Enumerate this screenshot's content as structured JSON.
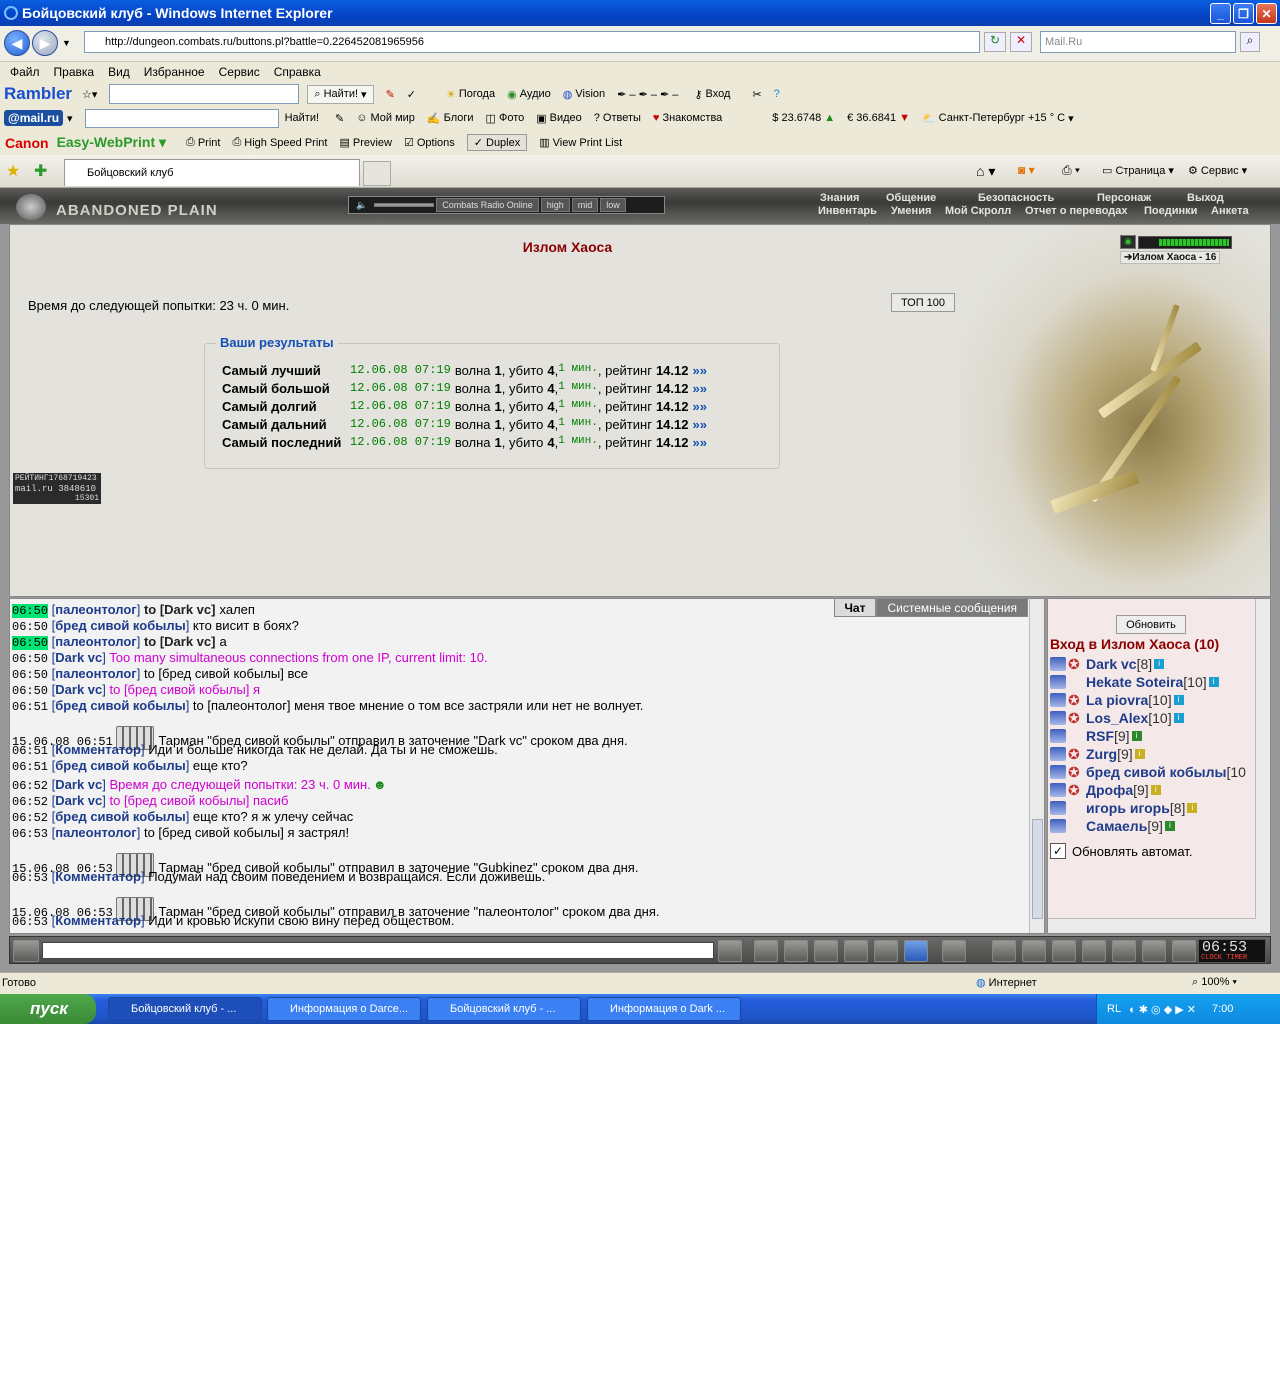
{
  "window": {
    "title": "Бойцовский клуб - Windows Internet Explorer"
  },
  "address": {
    "url": "http://dungeon.combats.ru/buttons.pl?battle=0.226452081965956",
    "search_placeholder": "Mail.Ru"
  },
  "menu": [
    "Файл",
    "Правка",
    "Вид",
    "Избранное",
    "Сервис",
    "Справка"
  ],
  "rambler": {
    "brand": "Rambler",
    "find": "Найти!",
    "items": [
      "Погода",
      "Аудио",
      "Vision",
      "Вход"
    ]
  },
  "mailru": {
    "brand": "@mail.ru",
    "find": "Найти!",
    "items": [
      "Мой мир",
      "Блоги",
      "Фото",
      "Видео",
      "Ответы",
      "Знакомства"
    ],
    "usd": "$ 23.6748",
    "eur": "€ 36.6841",
    "weather": "Санкт-Петербург +15 ° C"
  },
  "canon": {
    "brand": "Canon",
    "product": "Easy-WebPrint",
    "items": [
      "Print",
      "High Speed Print",
      "Preview",
      "Options",
      "Duplex",
      "View Print List"
    ]
  },
  "tabs": {
    "active": "Бойцовский клуб",
    "right_items": [
      "Страница",
      "Сервис"
    ]
  },
  "game": {
    "logo": "ABANDONED PLAIN",
    "radio": {
      "station": "Combats Radio Online",
      "high": "high",
      "mid": "mid",
      "low": "low"
    },
    "nav_top": [
      "Знания",
      "Общение",
      "Безопасность",
      "Персонаж",
      "Выход"
    ],
    "nav_bottom": [
      "Инвентарь",
      "Умения",
      "Мой Скролл",
      "Отчет о переводах",
      "Поединки",
      "Анкета"
    ],
    "page_title": "Излом Хаоса",
    "next_try": "Время до следующей попытки: 23 ч. 0 мин.",
    "top100": "ТОП 100",
    "zone_label": "Излом Хаоса - 16",
    "results": {
      "title": "Ваши результаты",
      "rows": [
        {
          "label": "Самый лучший",
          "date": "12.06.08 07:19",
          "wave_t": "волна",
          "wave": "1",
          "killed_t": ", убито",
          "killed": "4",
          "time": "1 мин.",
          "rating_t": ", рейтинг",
          "rating": "14.12",
          "more": "»»"
        },
        {
          "label": "Самый большой",
          "date": "12.06.08 07:19",
          "wave_t": "волна",
          "wave": "1",
          "killed_t": ", убито",
          "killed": "4",
          "time": "1 мин.",
          "rating_t": ", рейтинг",
          "rating": "14.12",
          "more": "»»"
        },
        {
          "label": "Самый долгий",
          "date": "12.06.08 07:19",
          "wave_t": "волна",
          "wave": "1",
          "killed_t": ", убито",
          "killed": "4",
          "time": "1 мин.",
          "rating_t": ", рейтинг",
          "rating": "14.12",
          "more": "»»"
        },
        {
          "label": "Самый дальний",
          "date": "12.06.08 07:19",
          "wave_t": "волна",
          "wave": "1",
          "killed_t": ", убито",
          "killed": "4",
          "time": "1 мин.",
          "rating_t": ", рейтинг",
          "rating": "14.12",
          "more": "»»"
        },
        {
          "label": "Самый последний",
          "date": "12.06.08 07:19",
          "wave_t": "волна",
          "wave": "1",
          "killed_t": ", убито",
          "killed": "4",
          "time": "1 мин.",
          "rating_t": ", рейтинг",
          "rating": "14.12",
          "more": "»»"
        }
      ]
    },
    "counter": {
      "l1": "РЕЙТИНГ1768719423",
      "l2": "mail.ru 3848610",
      "l3": "15301"
    },
    "chat_tabs": [
      "Чат",
      "Системные сообщения"
    ],
    "chat": [
      {
        "time": "06:50",
        "hl": true,
        "nick": "палеонтолог",
        "to": "to [Dark vc]",
        "text": "халеп",
        "style": "to"
      },
      {
        "time": "06:50",
        "nick": "бред сивой кобылы",
        "text": "кто висит в боях?",
        "style": "plain"
      },
      {
        "time": "06:50",
        "hl": true,
        "nick": "палеонтолог",
        "to": "to [Dark vc]",
        "text": "а",
        "style": "to"
      },
      {
        "time": "06:50",
        "nick": "Dark vc",
        "text": "Too many simultaneous connections from one IP, current limit: 10.",
        "style": "magenta"
      },
      {
        "time": "06:50",
        "nick": "палеонтолог",
        "text": "to [бред сивой кобылы] все",
        "style": "plain"
      },
      {
        "time": "06:50",
        "nick": "Dark vc",
        "text": "to [бред сивой кобылы] я",
        "style": "magenta"
      },
      {
        "time": "06:51",
        "nick": "бред сивой кобылы",
        "text": "to [палеонтолог] меня твое мнение о том все застряли или нет не волнует.",
        "style": "plain"
      },
      {
        "time": "15.06.08 06:51",
        "text": "Тарман \"бред сивой кобылы\" отправил в заточение \"Dark vc\" сроком два дня.",
        "style": "system"
      },
      {
        "time": "06:51",
        "nick": "Комментатор",
        "text": "Иди и больше никогда так не делай. Да ты и не сможешь.",
        "style": "plain"
      },
      {
        "time": "06:51",
        "nick": "бред сивой кобылы",
        "text": "еще кто?",
        "style": "plain"
      },
      {
        "time": "06:52",
        "nick": "Dark vc",
        "text": "Время до следующей попытки: 23 ч. 0 мин.",
        "style": "magenta"
      },
      {
        "time": "06:52",
        "nick": "Dark vc",
        "text": "to [бред сивой кобылы] пасиб",
        "style": "magenta"
      },
      {
        "time": "06:52",
        "nick": "бред сивой кобылы",
        "text": "еще кто? я ж улечу сейчас",
        "style": "plain"
      },
      {
        "time": "06:53",
        "nick": "палеонтолог",
        "text": "to [бред сивой кобылы] я застрял!",
        "style": "plain"
      },
      {
        "time": "15.06.08 06:53",
        "text": "Тарман \"бред сивой кобылы\" отправил в заточение \"Gubkinez\" сроком два дня.",
        "style": "system"
      },
      {
        "time": "06:53",
        "nick": "Комментатор",
        "text": "Подумай над своим поведением и возвращайся. Если доживешь.",
        "style": "plain"
      },
      {
        "time": "15.06.08 06:53",
        "text": "Тарман \"бред сивой кобылы\" отправил в заточение \"палеонтолог\" сроком два дня.",
        "style": "system"
      },
      {
        "time": "06:53",
        "nick": "Комментатор",
        "text": "Иди и кровью искупи свою вину перед обществом.",
        "style": "plain"
      }
    ],
    "online": {
      "refresh": "Обновить",
      "title": "Вход в Излом Хаоса (10)",
      "users": [
        {
          "name": "Dark vc",
          "level": "[8]"
        },
        {
          "name": "Hekate Soteira",
          "level": "[10]"
        },
        {
          "name": "La piovra",
          "level": "[10]"
        },
        {
          "name": "Los_Alex",
          "level": "[10]"
        },
        {
          "name": "RSF",
          "level": "[9]"
        },
        {
          "name": "Zurg",
          "level": "[9]"
        },
        {
          "name": "бред сивой кобылы",
          "level": "[10"
        },
        {
          "name": "Дрофа",
          "level": "[9]"
        },
        {
          "name": "игорь игорь",
          "level": "[8]"
        },
        {
          "name": "Самаель",
          "level": "[9]"
        }
      ],
      "auto": "Обновлять автомат."
    },
    "clock": {
      "time": "06:53",
      "label": "CLOCK TIMER"
    }
  },
  "status": {
    "left": "Готово",
    "zone": "Интернет",
    "zoom": "100%"
  },
  "taskbar": {
    "start": "пуск",
    "tasks": [
      "Бойцовский клуб - ...",
      "Информация о Darce...",
      "Бойцовский клуб - ...",
      "Информация о Dark ..."
    ],
    "lang": "RL",
    "time": "7:00"
  }
}
